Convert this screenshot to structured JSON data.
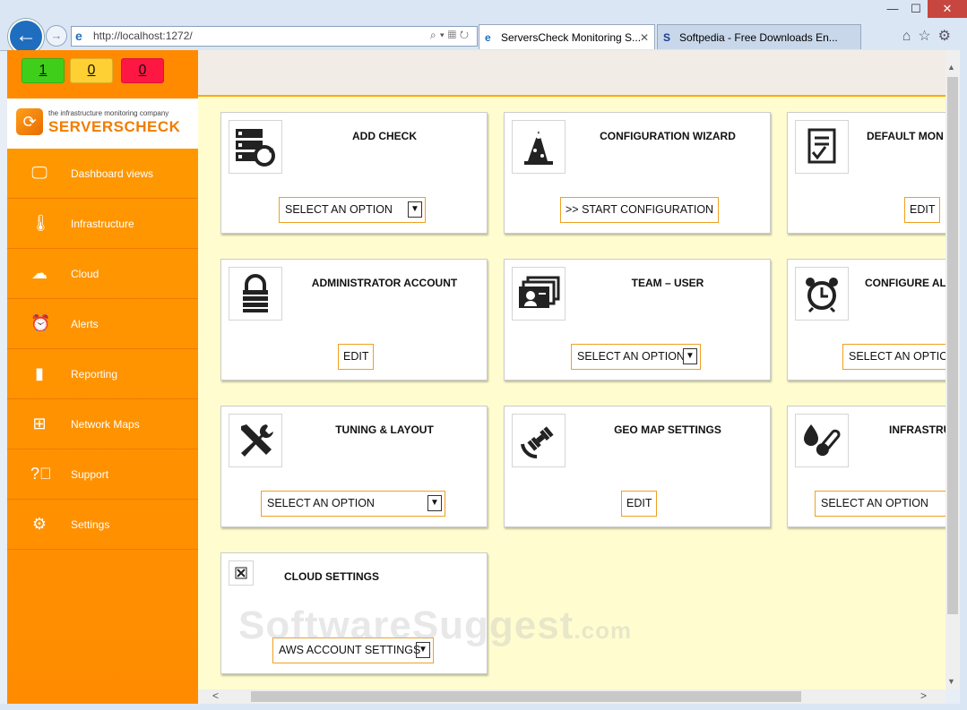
{
  "browser": {
    "window_buttons": {
      "minimize": "—",
      "maximize": "☐",
      "close": "✕"
    },
    "address": "http://localhost:1272/",
    "tabs": [
      {
        "title": "ServersCheck Monitoring S...",
        "icon": "ie-icon"
      },
      {
        "title": "Softpedia - Free Downloads En...",
        "icon": "softpedia-icon"
      }
    ]
  },
  "counters": [
    "1",
    "0",
    "0"
  ],
  "logo": {
    "tagline": "the infrastructure monitoring company",
    "name": "SERVERSCHECK"
  },
  "nav": [
    {
      "label": "Dashboard views",
      "icon": "monitor-icon"
    },
    {
      "label": "Infrastructure",
      "icon": "thermometer-icon"
    },
    {
      "label": "Cloud",
      "icon": "cloud-icon"
    },
    {
      "label": "Alerts",
      "icon": "alarm-clock-icon"
    },
    {
      "label": "Reporting",
      "icon": "bar-chart-icon"
    },
    {
      "label": "Network Maps",
      "icon": "network-icon"
    },
    {
      "label": "Support",
      "icon": "question-icon"
    },
    {
      "label": "Settings",
      "icon": "gear-icon"
    }
  ],
  "cards": [
    {
      "title": "ADD CHECK",
      "control": "SELECT AN OPTION",
      "kind": "select"
    },
    {
      "title": "CONFIGURATION WIZARD",
      "control": ">> START CONFIGURATION",
      "kind": "button"
    },
    {
      "title": "DEFAULT MON",
      "control": "EDIT",
      "kind": "button"
    },
    {
      "title": "ADMINISTRATOR ACCOUNT",
      "control": "EDIT",
      "kind": "button"
    },
    {
      "title": "TEAM – USER",
      "control": "SELECT AN OPTION",
      "kind": "select"
    },
    {
      "title": "CONFIGURE AL",
      "control": "SELECT AN OPTION",
      "kind": "select"
    },
    {
      "title": "TUNING & LAYOUT",
      "control": "SELECT AN OPTION",
      "kind": "select"
    },
    {
      "title": "GEO MAP SETTINGS",
      "control": "EDIT",
      "kind": "button"
    },
    {
      "title": "INFRASTRU",
      "control": "SELECT AN OPTION",
      "kind": "select"
    },
    {
      "title": "CLOUD SETTINGS",
      "control": "AWS ACCOUNT SETTINGS",
      "kind": "select"
    }
  ],
  "watermark": {
    "main": "SoftwareSuggest",
    "suffix": ".com"
  }
}
